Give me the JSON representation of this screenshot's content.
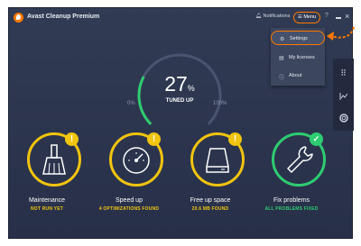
{
  "app": {
    "title": "Avast Cleanup Premium"
  },
  "titlebar": {
    "notifications_label": "Notifications",
    "menu_label": "Menu",
    "help_glyph": "?",
    "minimize_glyph": "–",
    "close_glyph": "×"
  },
  "menu": {
    "items": [
      {
        "label": "Settings",
        "icon": "gear-icon"
      },
      {
        "label": "My licenses",
        "icon": "license-icon"
      },
      {
        "label": "About",
        "icon": "info-icon"
      }
    ]
  },
  "side_nav": {
    "icons": [
      "grid-icon",
      "chart-icon",
      "lifebuoy-icon"
    ]
  },
  "gauge": {
    "value": 27,
    "value_text": "27",
    "unit": "%",
    "label": "TUNED UP",
    "min_label": "0%",
    "max_label": "100%"
  },
  "cards": [
    {
      "title": "Maintenance",
      "status": "NOT RUN YET",
      "icon": "broom-icon",
      "badge": "!"
    },
    {
      "title": "Speed up",
      "status": "4 OPTIMIZATIONS FOUND",
      "icon": "speedometer-icon",
      "badge": "!"
    },
    {
      "title": "Free up space",
      "status": "20.6 MB FOUND",
      "icon": "hard-drive-icon",
      "badge": "!"
    },
    {
      "title": "Fix problems",
      "status": "ALL PROBLEMS FIXED",
      "icon": "wrench-icon",
      "badge": "✓"
    }
  ],
  "colors": {
    "accent": "#ff7800",
    "warning": "#f1c40f",
    "success": "#2ecc71",
    "background": "#2c3449"
  }
}
